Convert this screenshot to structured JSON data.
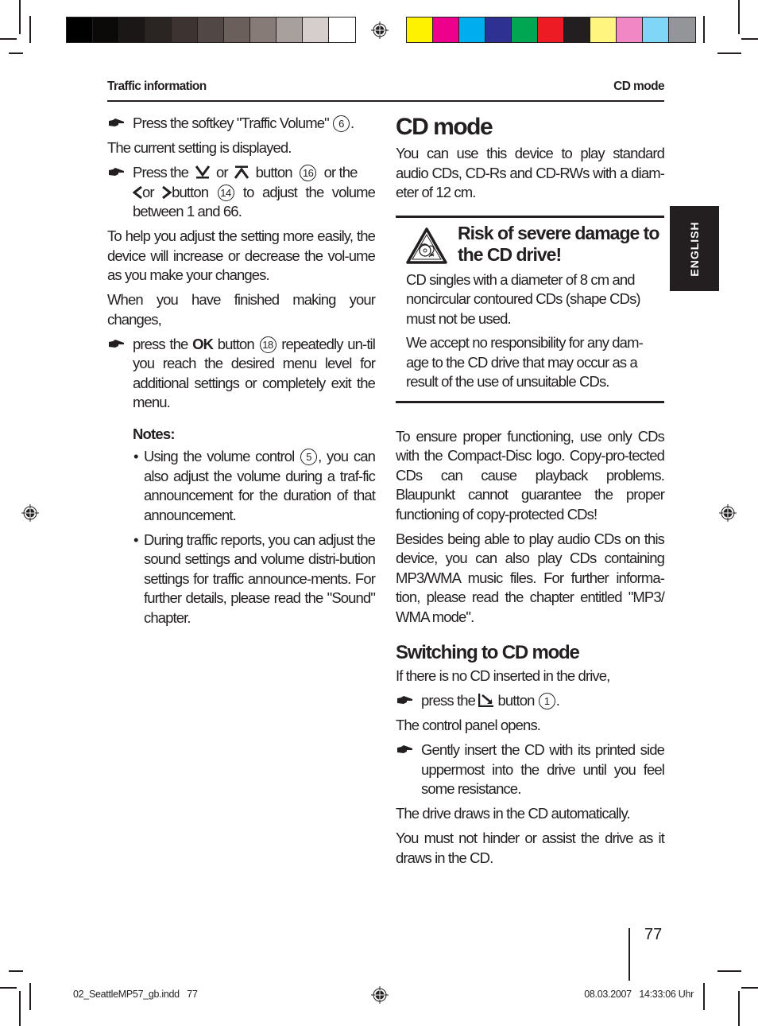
{
  "print_marks": {
    "gray_swatches": [
      "#000000",
      "#0c0a09",
      "#1a1716",
      "#2a2422",
      "#3d3331",
      "#514845",
      "#6a5f5b",
      "#877b77",
      "#a8a09d",
      "#d5cecd",
      "#ffffff"
    ],
    "color_swatches": [
      "#fff200",
      "#ec008c",
      "#00aeef",
      "#2e3192",
      "#00a651",
      "#ed1c24",
      "#231f20",
      "#fff57f",
      "#f287c5",
      "#7fd6f7",
      "#939598"
    ]
  },
  "header": {
    "left": "Traffic information",
    "right": "CD mode"
  },
  "side_tab": {
    "label": "ENGLISH"
  },
  "left_column": {
    "step1": {
      "text_before": "Press the softkey \"Traffic Volume\"",
      "num": "6",
      "text_after": "."
    },
    "p1": "The current setting is displayed.",
    "step2": {
      "t1": "Press the",
      "t2": "or",
      "t3": "button",
      "num1": "16",
      "t4": "or the",
      "t5": "or",
      "t6": "button",
      "num2": "14",
      "t7": "to adjust the volume between 1 and 66."
    },
    "p2": "To help you adjust the setting more easily, the device will increase or decrease the vol-ume as you make your changes.",
    "p3": "When you have finished making your changes,",
    "step3": {
      "t1": "press the",
      "bold": "OK",
      "t2": "button",
      "num": "18",
      "t3": "repeatedly un-til you reach the desired menu level for additional settings or completely exit the menu."
    },
    "notes_heading": "Notes:",
    "notes": [
      {
        "bullet": "•",
        "t1": "Using the volume control",
        "num": "5",
        "t2": ", you can also adjust the volume during a traf-fic announcement for the duration of that announcement."
      },
      {
        "bullet": "•",
        "t1": "During traffic reports, you can adjust the sound settings and volume distri-bution settings for traffic announce-ments. For further details, please read the \"Sound\" chapter."
      }
    ]
  },
  "right_column": {
    "title": "CD mode",
    "intro": "You can use this device to play standard audio CDs, CD-Rs and CD-RWs with a diam-eter of 12 cm.",
    "warning": {
      "icon": "cd-damage-warning-icon",
      "heading": "Risk of severe damage to the CD drive!",
      "p1": "CD singles with a diameter of 8 cm and noncircular contoured CDs (shape CDs) must not be used.",
      "p2": "We accept no responsibility for any dam-age to the CD drive that may occur as a result of the use of unsuitable CDs."
    },
    "p1": "To ensure proper functioning, use only CDs with the Compact-Disc logo. Copy-pro-tected CDs can cause playback problems. Blaupunkt cannot guarantee the proper functioning of copy-protected CDs!",
    "p2": "Besides being able to play audio CDs on this device, you can also play CDs containing MP3/WMA music files. For further informa-tion, please read the chapter entitled \"MP3/ WMA mode\".",
    "subheading": "Switching to CD mode",
    "p3": "If there is no CD inserted in the drive,",
    "step1": {
      "t1": "press the",
      "t2": "button",
      "num": "1",
      "t3": "."
    },
    "p4": "The control panel opens.",
    "step2": "Gently insert the CD with its printed side uppermost into the drive until you feel some resistance.",
    "p5": "The drive draws in the CD automatically.",
    "p6": "You must not hinder or assist the drive as it draws in the CD."
  },
  "footer": {
    "page_number": "77",
    "slug_left": "02_SeattleMP57_gb.indd   77",
    "slug_right": "08.03.2007   14:33:06 Uhr"
  }
}
